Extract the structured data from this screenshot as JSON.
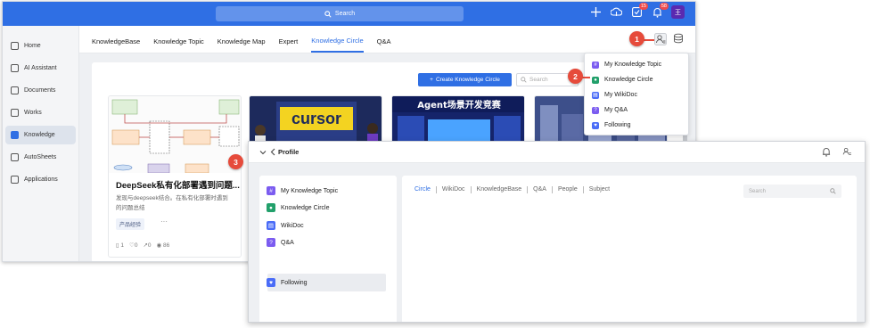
{
  "app": {
    "search_placeholder": "Search",
    "badges": {
      "tasks": "15",
      "notifications": "58"
    },
    "avatar_letter": "王",
    "accent_color": "#2f6fe4"
  },
  "sidebar": {
    "items": [
      {
        "label": "Home",
        "icon": "home-icon"
      },
      {
        "label": "AI Assistant",
        "icon": "robot-icon"
      },
      {
        "label": "Documents",
        "icon": "folder-icon"
      },
      {
        "label": "Works",
        "icon": "grid-icon"
      },
      {
        "label": "Knowledge",
        "icon": "book-icon",
        "active": true
      },
      {
        "label": "AutoSheets",
        "icon": "sheet-icon"
      },
      {
        "label": "Applications",
        "icon": "apps-icon"
      }
    ]
  },
  "tabs": [
    {
      "label": "KnowledgeBase"
    },
    {
      "label": "Knowledge Topic"
    },
    {
      "label": "Knowledge Map"
    },
    {
      "label": "Expert"
    },
    {
      "label": "Knowledge Circle",
      "active": true
    },
    {
      "label": "Q&A"
    }
  ],
  "toolbar": {
    "create_label": "Create Knowledge Circle",
    "search_placeholder": "Search"
  },
  "cards": [
    {
      "title": "DeepSeek私有化部署遇到问题...",
      "desc": "发现与deepseek结合。在私有化部署时遇到的问题总结",
      "tag": "产品经验",
      "more": "···",
      "stats": {
        "docs": "1",
        "likes": "0",
        "shares": "0",
        "views": "86"
      }
    },
    {
      "banner": "cursor"
    },
    {
      "banner": "Agent场景开发竞赛"
    },
    {
      "banner": ""
    }
  ],
  "dropdown": {
    "items": [
      {
        "label": "My Knowledge Topic",
        "icon": "hash-icon",
        "color": "#7b5cf0"
      },
      {
        "label": "Knowledge Circle",
        "icon": "circle-icon",
        "color": "#22a06b"
      },
      {
        "label": "My WikiDoc",
        "icon": "wikidoc-icon",
        "color": "#4a6cf7"
      },
      {
        "label": "My Q&A",
        "icon": "qa-icon",
        "color": "#7b5cf0"
      },
      {
        "label": "Following",
        "icon": "heart-icon",
        "color": "#4a6cf7"
      }
    ]
  },
  "annotations": [
    "1",
    "2",
    "3"
  ],
  "profile": {
    "title": "Profile",
    "left_items": [
      {
        "label": "My Knowledge Topic",
        "icon": "hash-icon",
        "color": "#7b5cf0"
      },
      {
        "label": "Knowledge Circle",
        "icon": "circle-icon",
        "color": "#22a06b"
      },
      {
        "label": "WikiDoc",
        "icon": "wikidoc-icon",
        "color": "#4a6cf7"
      },
      {
        "label": "Q&A",
        "icon": "qa-icon",
        "color": "#7b5cf0"
      },
      {
        "label": "Following",
        "icon": "heart-icon",
        "color": "#4a6cf7",
        "selected": true
      }
    ],
    "subtabs": [
      "Circle",
      "WikiDoc",
      "KnowledgeBase",
      "Q&A",
      "People",
      "Subject"
    ],
    "search_placeholder": "Search"
  }
}
